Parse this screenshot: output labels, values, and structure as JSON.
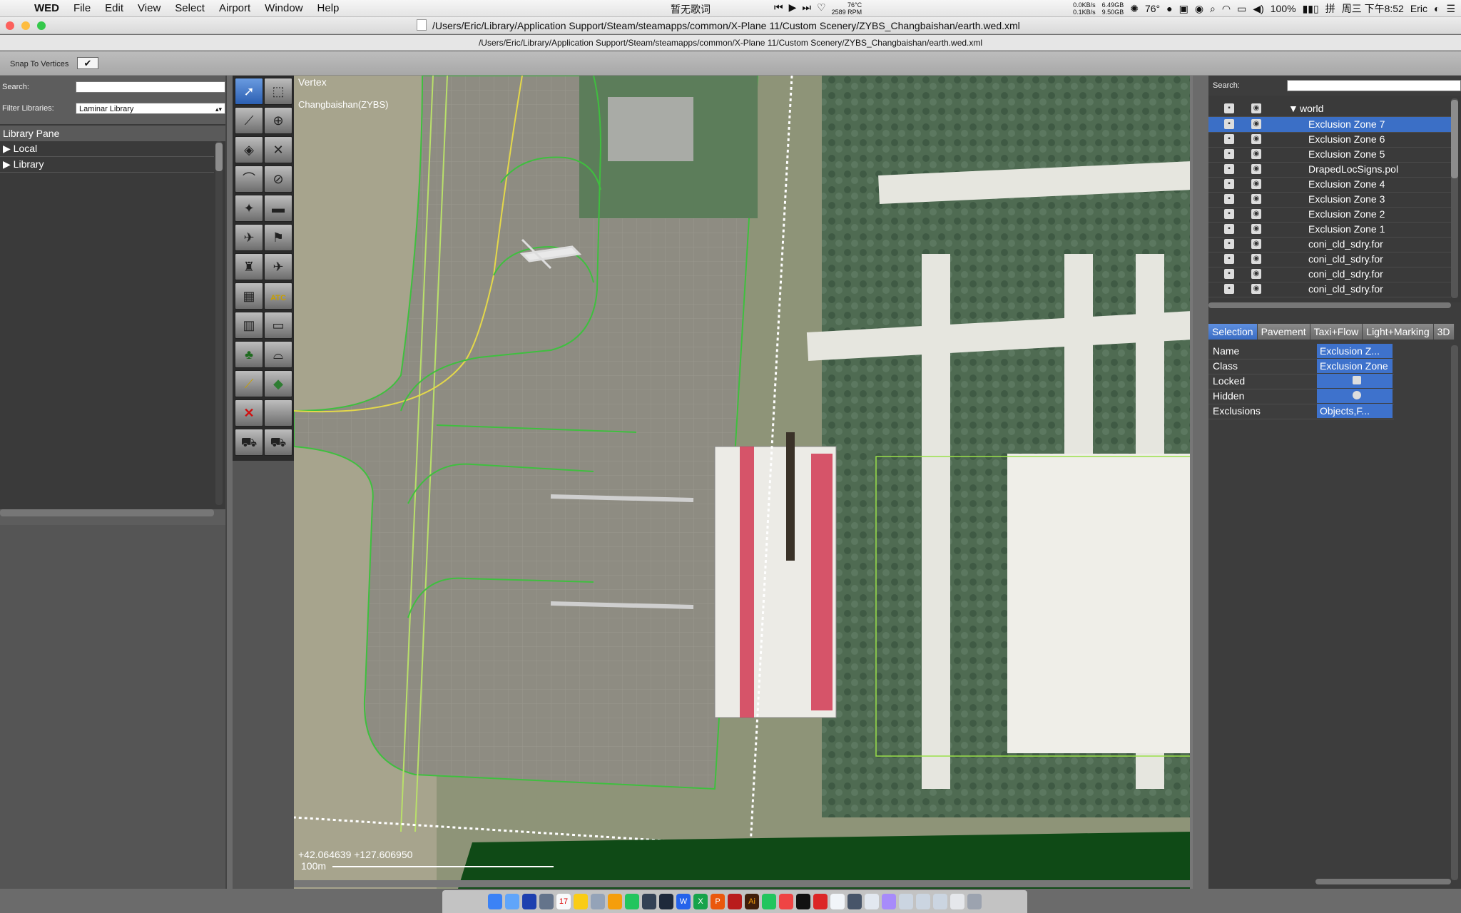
{
  "menubar": {
    "app_name": "WED",
    "items": [
      "File",
      "Edit",
      "View",
      "Select",
      "Airport",
      "Window",
      "Help"
    ],
    "now_playing": "暂无歌词",
    "cpu_temp": "76°C",
    "fan_rpm": "2589 RPM",
    "net_up": "0.0KB/s",
    "net_down": "0.1KB/s",
    "mem_used": "6.49GB",
    "mem_free": "9.50GB",
    "weather": "76°",
    "battery": "100%",
    "clock": "周三 下午8:52",
    "user": "Eric"
  },
  "window": {
    "title": "/Users/Eric/Library/Application Support/Steam/steamapps/common/X-Plane 11/Custom Scenery/ZYBS_Changbaishan/earth.wed.xml",
    "path": "/Users/Eric/Library/Application Support/Steam/steamapps/common/X-Plane 11/Custom Scenery/ZYBS_Changbaishan/earth.wed.xml"
  },
  "toolbar": {
    "snap_label": "Snap To Vertices",
    "snap_check": "✔"
  },
  "left_panel": {
    "search_label": "Search:",
    "filter_label": "Filter Libraries:",
    "filter_value": "Laminar Library",
    "pane_title": "Library Pane",
    "items": [
      {
        "label": "Local"
      },
      {
        "label": "Library"
      }
    ]
  },
  "tools": {
    "atc_label": "ATC"
  },
  "map": {
    "tool_name": "Vertex",
    "airport_name": "Changbaishan(ZYBS)",
    "coords": "+42.064639 +127.606950",
    "scale": "100m"
  },
  "right_panel": {
    "search_label": "Search:",
    "tree": [
      {
        "label": "world",
        "selected": false,
        "root": true
      },
      {
        "label": "Exclusion Zone 7",
        "selected": true
      },
      {
        "label": "Exclusion Zone 6",
        "selected": false
      },
      {
        "label": "Exclusion Zone 5",
        "selected": false
      },
      {
        "label": "DrapedLocSigns.pol",
        "selected": false
      },
      {
        "label": "Exclusion Zone 4",
        "selected": false
      },
      {
        "label": "Exclusion Zone 3",
        "selected": false
      },
      {
        "label": "Exclusion Zone 2",
        "selected": false
      },
      {
        "label": "Exclusion Zone 1",
        "selected": false
      },
      {
        "label": "coni_cld_sdry.for",
        "selected": false
      },
      {
        "label": "coni_cld_sdry.for",
        "selected": false
      },
      {
        "label": "coni_cld_sdry.for",
        "selected": false
      },
      {
        "label": "coni_cld_sdry.for",
        "selected": false
      }
    ],
    "tabs": [
      "Selection",
      "Pavement",
      "Taxi+Flow",
      "Light+Marking",
      "3D"
    ],
    "properties": [
      {
        "key": "Name",
        "value": "Exclusion Z..."
      },
      {
        "key": "Class",
        "value": "Exclusion Zone"
      },
      {
        "key": "Locked",
        "value": ""
      },
      {
        "key": "Hidden",
        "value": ""
      },
      {
        "key": "Exclusions",
        "value": "Objects,F..."
      }
    ]
  }
}
